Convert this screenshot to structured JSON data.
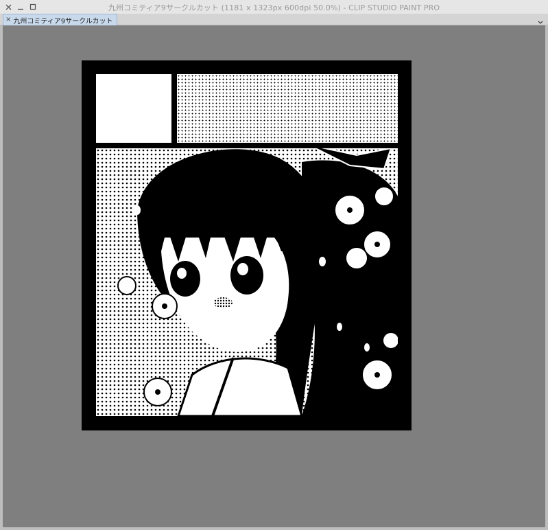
{
  "window": {
    "title": "九州コミティア9サークルカット (1181 x 1323px 600dpi 50.0%)  - CLIP STUDIO PAINT PRO"
  },
  "tabs": [
    {
      "label": "九州コミティア9サークルカット",
      "close_glyph": "×",
      "active": true
    }
  ],
  "icons": {
    "close": "close-icon",
    "minimize": "minimize-icon",
    "maximize": "maximize-icon",
    "tab_menu": "chevron-down-icon"
  },
  "colors": {
    "workspace": "#7f7f7f",
    "active_tab": "#c9d9ec",
    "artwork_frame": "#000000"
  }
}
